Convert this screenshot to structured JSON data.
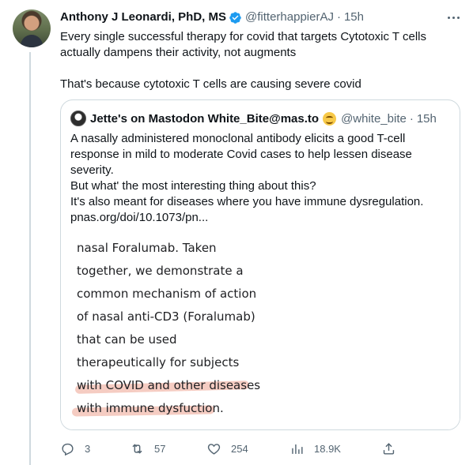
{
  "tweet": {
    "author_name": "Anthony J Leonardi, PhD, MS",
    "handle": "@fitterhappierAJ",
    "time": "15h",
    "text_lines": [
      "Every single successful therapy for covid that targets Cytotoxic T cells",
      "actually dampens their activity, not augments",
      "That's because cytotoxic T cells are causing severe covid"
    ]
  },
  "quoted_tweet": {
    "author_name": "Jette's on Mastodon White_Bite@mas.to",
    "handle": "@white_bite",
    "time": "15h",
    "text_lines": [
      "A nasally administered monoclonal antibody elicits a good T-cell",
      "response in mild to moderate Covid cases to help lessen disease",
      "severity.",
      "But what' the most interesting thing about this?",
      "It's also meant for diseases where you have immune dysregulation.",
      "pnas.org/doi/10.1073/pn..."
    ],
    "image_text_lines": [
      "nasal Foralumab. Taken",
      "together, we demonstrate a",
      "common mechanism of action",
      "of nasal anti-CD3 (Foralumab)",
      "that can be used",
      "therapeutically for subjects",
      "with COVID and other diseases",
      "with immune dysfuction."
    ]
  },
  "actions": {
    "replies": "3",
    "retweets": "57",
    "likes": "254",
    "views": "18.9K"
  },
  "colors": {
    "text": "#0f1419",
    "secondary": "#536471",
    "border": "#cfd9de",
    "verified": "#1d9bf0",
    "highlight": "#f1b7a8"
  },
  "icons": [
    "verified-badge-icon",
    "more-icon",
    "reply-icon",
    "retweet-icon",
    "like-icon",
    "views-icon",
    "share-icon"
  ]
}
